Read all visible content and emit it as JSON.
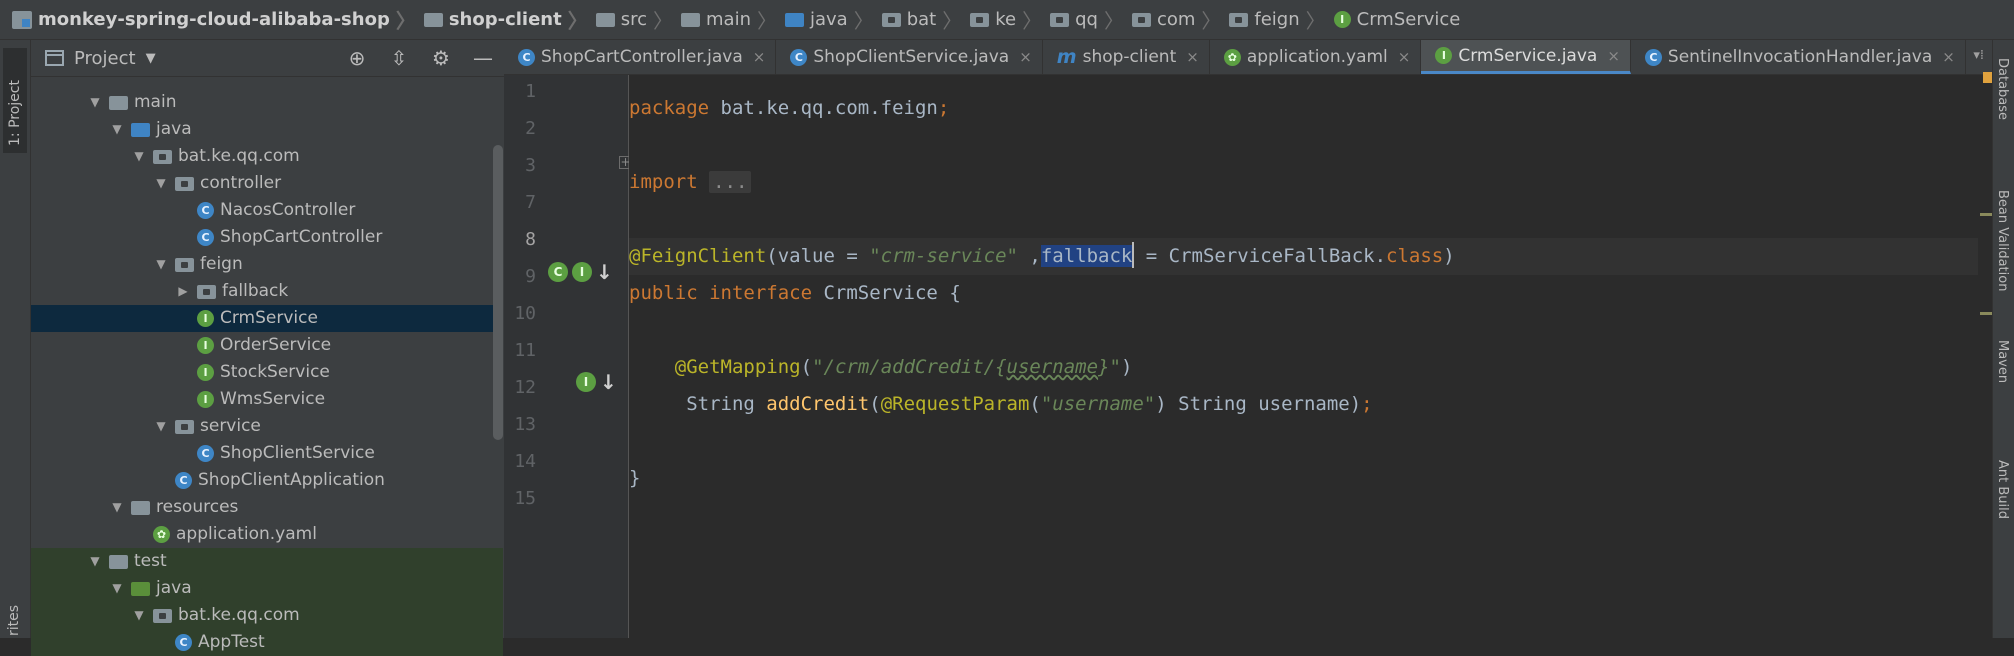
{
  "breadcrumb": [
    {
      "label": "monkey-spring-cloud-alibaba-shop",
      "icon": "module-icon",
      "bold": true
    },
    {
      "label": "shop-client",
      "icon": "folder-icon",
      "bold": true
    },
    {
      "label": "src",
      "icon": "folder-icon"
    },
    {
      "label": "main",
      "icon": "folder-icon"
    },
    {
      "label": "java",
      "icon": "source-folder-icon"
    },
    {
      "label": "bat",
      "icon": "package-icon"
    },
    {
      "label": "ke",
      "icon": "package-icon"
    },
    {
      "label": "qq",
      "icon": "package-icon"
    },
    {
      "label": "com",
      "icon": "package-icon"
    },
    {
      "label": "feign",
      "icon": "package-icon"
    },
    {
      "label": "CrmService",
      "icon": "interface-icon"
    }
  ],
  "left_stripe": {
    "project_tab": "1: Project",
    "favorites_tab": "rites"
  },
  "right_stripe": [
    "Database",
    "Bean Validation",
    "Maven",
    "Ant Build"
  ],
  "project_panel": {
    "title": "Project",
    "tools": [
      "target-icon",
      "collapse-icon",
      "gear-icon",
      "minimize-icon"
    ],
    "tree": [
      {
        "label": "main",
        "indent": 1,
        "arrow": "down",
        "icon": "folder"
      },
      {
        "label": "java",
        "indent": 2,
        "arrow": "down",
        "icon": "src-folder"
      },
      {
        "label": "bat.ke.qq.com",
        "indent": 3,
        "arrow": "down",
        "icon": "package"
      },
      {
        "label": "controller",
        "indent": 4,
        "arrow": "down",
        "icon": "package"
      },
      {
        "label": "NacosController",
        "indent": 5,
        "arrow": "none",
        "icon": "class"
      },
      {
        "label": "ShopCartController",
        "indent": 5,
        "arrow": "none",
        "icon": "class"
      },
      {
        "label": "feign",
        "indent": 4,
        "arrow": "down",
        "icon": "package"
      },
      {
        "label": "fallback",
        "indent": 5,
        "arrow": "right",
        "icon": "package"
      },
      {
        "label": "CrmService",
        "indent": 5,
        "arrow": "none",
        "icon": "interface",
        "selected": true
      },
      {
        "label": "OrderService",
        "indent": 5,
        "arrow": "none",
        "icon": "interface"
      },
      {
        "label": "StockService",
        "indent": 5,
        "arrow": "none",
        "icon": "interface"
      },
      {
        "label": "WmsService",
        "indent": 5,
        "arrow": "none",
        "icon": "interface"
      },
      {
        "label": "service",
        "indent": 4,
        "arrow": "down",
        "icon": "package"
      },
      {
        "label": "ShopClientService",
        "indent": 5,
        "arrow": "none",
        "icon": "class"
      },
      {
        "label": "ShopClientApplication",
        "indent": 4,
        "arrow": "none",
        "icon": "spring-class"
      },
      {
        "label": "resources",
        "indent": 2,
        "arrow": "down",
        "icon": "res-folder"
      },
      {
        "label": "application.yaml",
        "indent": 3,
        "arrow": "none",
        "icon": "yaml"
      },
      {
        "label": "test",
        "indent": 1,
        "arrow": "down",
        "icon": "folder",
        "test": true
      },
      {
        "label": "java",
        "indent": 2,
        "arrow": "down",
        "icon": "test-folder",
        "test": true
      },
      {
        "label": "bat.ke.qq.com",
        "indent": 3,
        "arrow": "down",
        "icon": "package",
        "test": true
      },
      {
        "label": "AppTest",
        "indent": 4,
        "arrow": "none",
        "icon": "class",
        "test": true
      }
    ]
  },
  "tabs": [
    {
      "label": "ShopCartController.java",
      "icon": "class"
    },
    {
      "label": "ShopClientService.java",
      "icon": "class"
    },
    {
      "label": "shop-client",
      "icon": "maven"
    },
    {
      "label": "application.yaml",
      "icon": "yaml"
    },
    {
      "label": "CrmService.java",
      "icon": "interface",
      "active": true
    },
    {
      "label": "SentinelInvocationHandler.java",
      "icon": "class"
    }
  ],
  "editor": {
    "line_numbers": [
      "1",
      "2",
      "3",
      "7",
      "8",
      "9",
      "10",
      "11",
      "12",
      "13",
      "14",
      "15"
    ],
    "current_line": "8",
    "lines": {
      "l1_kw": "package",
      "l1_rest": " bat.ke.qq.com.feign",
      "l1_semi": ";",
      "l3_kw": "import",
      "l3_fold": "...",
      "l8_anno": "@FeignClient",
      "l8_a": "(value = ",
      "l8_str": "\"crm-service\"",
      "l8_b": " ,",
      "l8_sel": "fallback",
      "l8_c": " = CrmServiceFallBack.",
      "l8_kw": "class",
      "l8_d": ")",
      "l9_kw1": "public",
      "l9_kw2": "interface",
      "l9_rest": " CrmService {",
      "l11_anno": "@GetMapping",
      "l11_a": "(",
      "l11_str1": "\"/crm/addCredit/{",
      "l11_str2": "username",
      "l11_str3": "}\"",
      "l11_b": ")",
      "l12_a": "String ",
      "l12_fn": "addCredit",
      "l12_b": "(",
      "l12_anno": "@RequestParam",
      "l12_c": "(",
      "l12_str": "\"username\"",
      "l12_d": ") String username)",
      "l12_semi": ";",
      "l14": "}"
    }
  }
}
